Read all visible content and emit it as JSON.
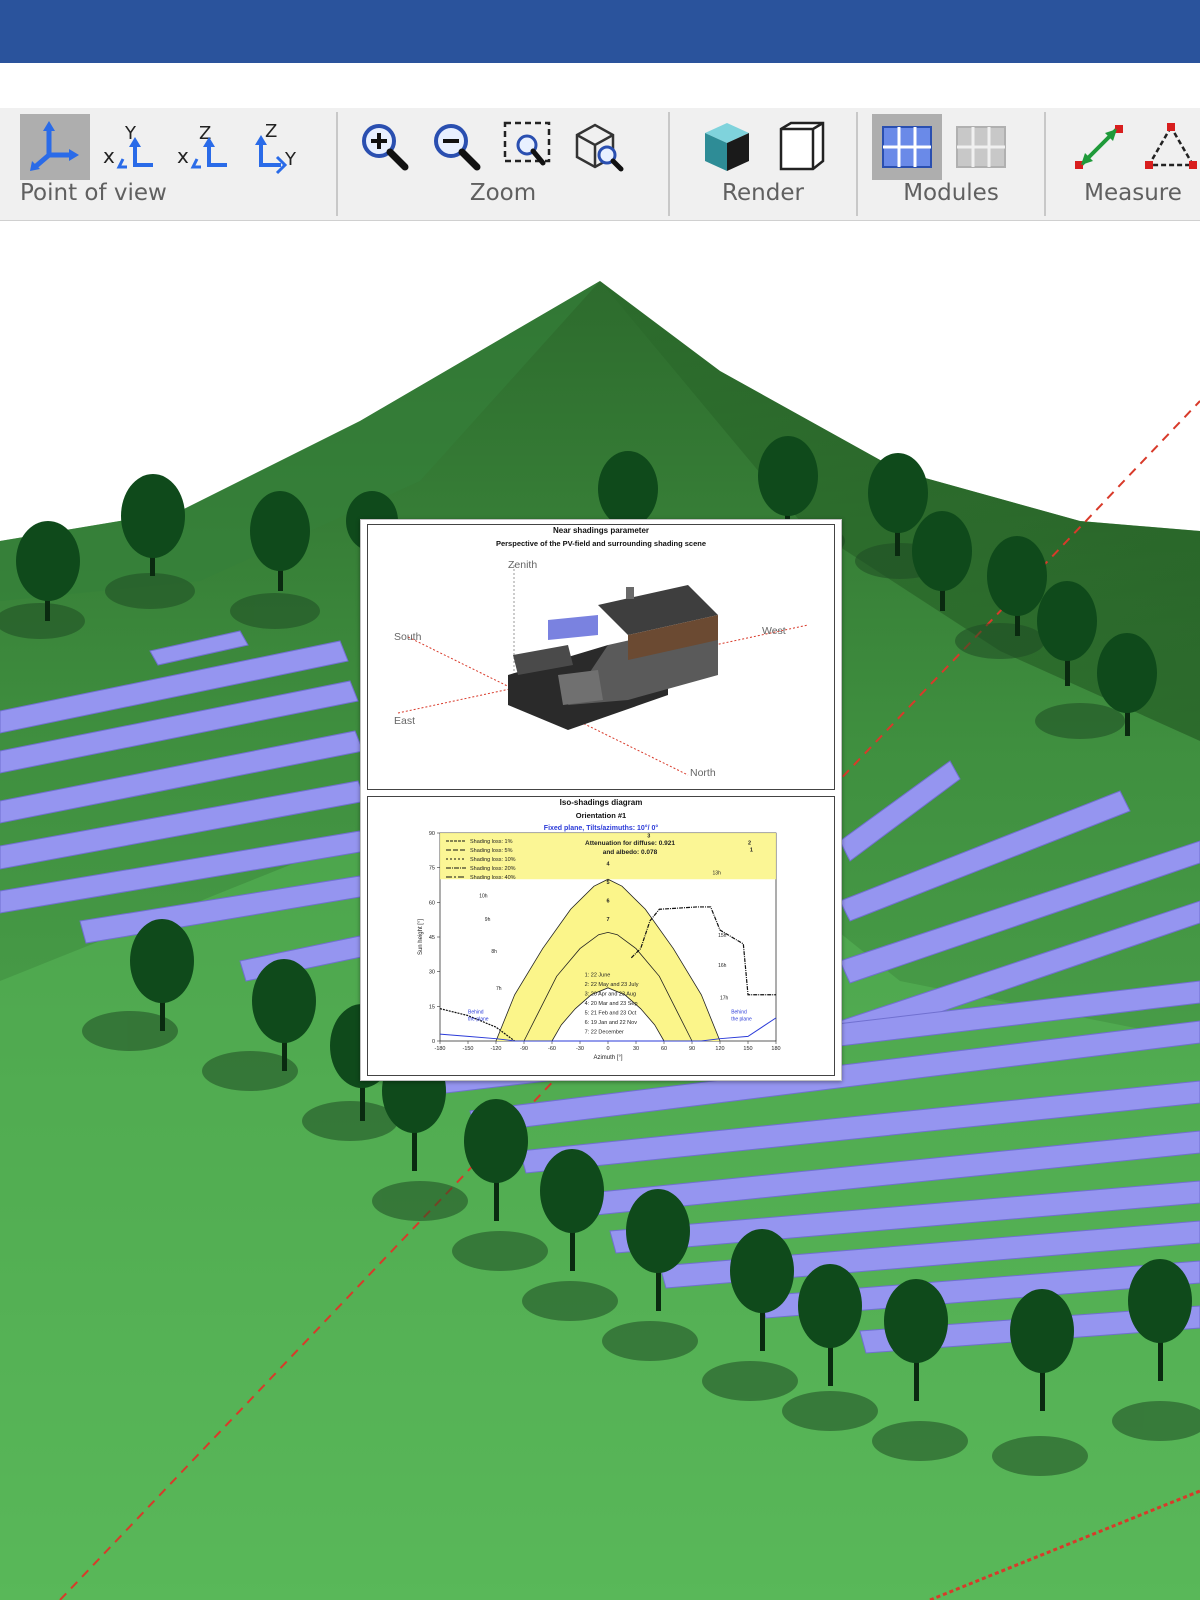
{
  "colors": {
    "titlebar": "#2a539c",
    "toolbar_bg": "#f0f0f0",
    "active_button": "#aeaeae",
    "terrain": "#4ea84e",
    "module": "#9595f0",
    "tree": "#0f4a1b",
    "axis_red": "#d83a2a"
  },
  "toolbar": {
    "groups": [
      {
        "label": "Point of view",
        "buttons": [
          {
            "icon": "rotate-view-icon"
          },
          {
            "icon": "xyz-axes-icon",
            "active": true
          },
          {
            "icon": "xy-plane-icon"
          },
          {
            "icon": "xz-plane-icon"
          },
          {
            "icon": "zy-plane-icon"
          }
        ]
      },
      {
        "label": "Zoom",
        "buttons": [
          {
            "icon": "zoom-in-icon"
          },
          {
            "icon": "zoom-out-icon"
          },
          {
            "icon": "zoom-selection-icon"
          },
          {
            "icon": "zoom-object-icon"
          }
        ]
      },
      {
        "label": "Render",
        "buttons": [
          {
            "icon": "render-solid-icon"
          },
          {
            "icon": "render-wireframe-icon"
          }
        ]
      },
      {
        "label": "Modules",
        "buttons": [
          {
            "icon": "modules-grid-icon",
            "active": true
          },
          {
            "icon": "modules-hidden-icon"
          }
        ]
      },
      {
        "label": "Measure",
        "buttons": [
          {
            "icon": "measure-distance-icon"
          },
          {
            "icon": "measure-angle-icon"
          }
        ]
      }
    ],
    "axis_letters": {
      "x": "x",
      "y": "Y",
      "z": "Z"
    }
  },
  "report": {
    "near_shadings": {
      "title": "Near shadings parameter",
      "subtitle": "Perspective of the PV-field and surrounding shading scene",
      "directions": {
        "zenith": "Zenith",
        "south": "South",
        "west": "West",
        "east": "East",
        "north": "North"
      }
    },
    "iso_shadings": {
      "title": "Iso-shadings diagram",
      "orientation": "Orientation #1",
      "fixed_plane": "Fixed plane, Tilts/azimuths: 10°/ 0°",
      "attenuation_line1": "Attenuation for diffuse: 0.921",
      "attenuation_line2": "and albedo: 0.078",
      "loss_legend": [
        "Shading loss: 1%",
        "Shading loss: 5%",
        "Shading loss: 10%",
        "Shading loss: 20%",
        "Shading loss: 40%"
      ],
      "dates_legend": [
        "1: 22 June",
        "2: 22 May and 23 July",
        "3: 20 Apr and 23 Aug",
        "4: 20 Mar and 23 Sep",
        "5: 21 Feb and 23 Oct",
        "6: 19 Jan and 22 Nov",
        "7: 22 December"
      ],
      "behind_left": [
        "Behind",
        "the plane"
      ],
      "behind_right": [
        "Behind",
        "the plane"
      ],
      "hour_labels_left": [
        "10h",
        "9h",
        "8h",
        "7h"
      ],
      "hour_labels_right": [
        "13h",
        "15h",
        "16h",
        "17h"
      ],
      "date_markers_top": [
        "3",
        "2",
        "1"
      ],
      "date_markers_center": [
        "4",
        "5",
        "6",
        "7"
      ]
    }
  },
  "chart_data": {
    "type": "line",
    "title": "Iso-shadings diagram",
    "xlabel": "Azimuth [°]",
    "ylabel": "Sun height [°]",
    "xlim": [
      -180,
      180
    ],
    "ylim": [
      0,
      90
    ],
    "xticks": [
      -180,
      -150,
      -120,
      -90,
      -60,
      -30,
      0,
      30,
      60,
      90,
      120,
      150,
      180
    ],
    "yticks": [
      0,
      15,
      30,
      45,
      60,
      75,
      90
    ],
    "sun_paths": [
      {
        "name": "1: 22 June",
        "x": [
          -120,
          -100,
          -70,
          -40,
          -15,
          0,
          15,
          40,
          70,
          100,
          120
        ],
        "y": [
          0,
          20,
          40,
          57,
          67,
          70,
          67,
          57,
          40,
          20,
          0
        ]
      },
      {
        "name": "4: 20 Mar and 23 Sep",
        "x": [
          -90,
          -75,
          -55,
          -30,
          -10,
          0,
          10,
          30,
          55,
          75,
          90
        ],
        "y": [
          0,
          12,
          28,
          40,
          46,
          47,
          46,
          40,
          28,
          12,
          0
        ]
      },
      {
        "name": "7: 22 December",
        "x": [
          -60,
          -50,
          -35,
          -18,
          0,
          18,
          35,
          50,
          60
        ],
        "y": [
          0,
          7,
          14,
          20,
          23,
          20,
          14,
          7,
          0
        ]
      }
    ],
    "shading_loss_curves": [
      {
        "name": "Shading loss: 1%",
        "x": [
          -180,
          -150,
          -120,
          -100
        ],
        "y": [
          14,
          11,
          6,
          0
        ]
      },
      {
        "name": "Shading loss: 40%",
        "x": [
          25,
          35,
          45,
          55,
          95,
          110,
          120,
          145,
          150,
          180
        ],
        "y": [
          36,
          40,
          52,
          57,
          58,
          58,
          48,
          42,
          20,
          20
        ]
      }
    ],
    "behind_plane": {
      "x": [
        -180,
        -150,
        -120,
        -100,
        100,
        120,
        150,
        180
      ],
      "y": [
        3,
        2,
        1,
        0,
        0,
        1,
        2,
        10
      ]
    }
  }
}
